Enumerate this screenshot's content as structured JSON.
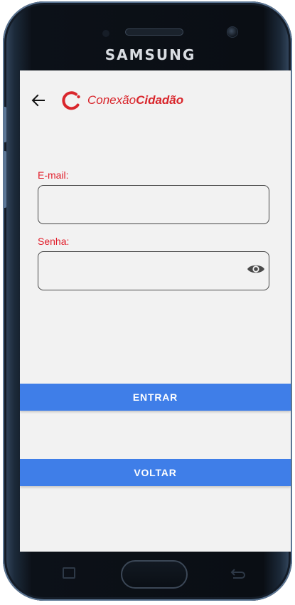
{
  "device": {
    "brand": "SAMSUNG"
  },
  "app_bar": {
    "back_icon": "arrow-left-icon",
    "logo": {
      "prefix": "Conexão",
      "suffix": "Cidadão",
      "accent_color": "#d9262c"
    }
  },
  "form": {
    "email": {
      "label": "E-mail:",
      "value": ""
    },
    "password": {
      "label": "Senha:",
      "value": "",
      "toggle_icon": "eye-icon"
    },
    "label_color": "#e11d2a"
  },
  "actions": {
    "enter_label": "ENTRAR",
    "back_label": "VOLTAR",
    "button_color": "#3f7ee8"
  }
}
